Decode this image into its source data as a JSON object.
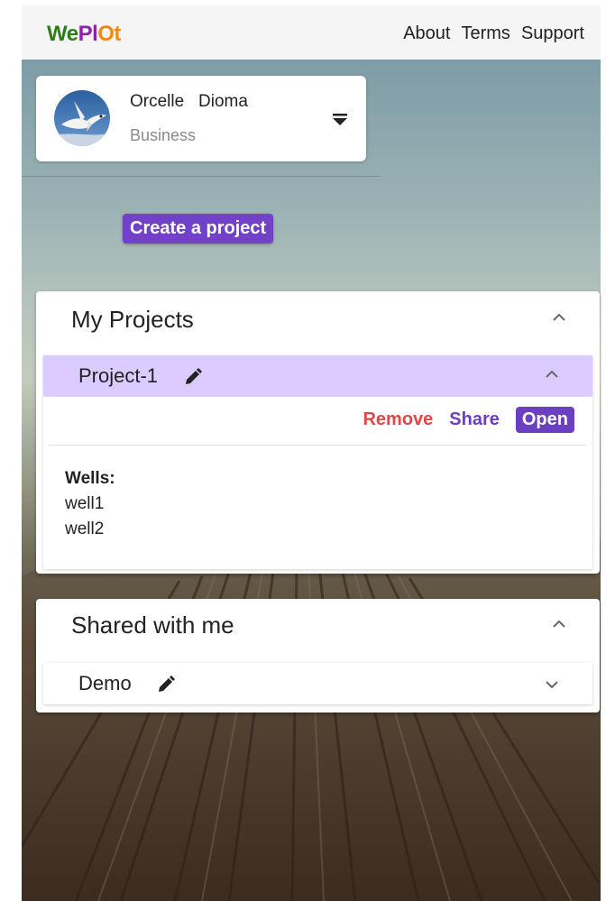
{
  "header": {
    "logo": [
      {
        "text": "We",
        "color": "#2e7d1a"
      },
      {
        "text": "Pl",
        "color": "#8e24aa"
      },
      {
        "text": "Ot",
        "color": "#ef8a10"
      }
    ],
    "nav": [
      "About",
      "Terms",
      "Support"
    ]
  },
  "user": {
    "name": "Orcelle   Dioma",
    "plan": "Business"
  },
  "create_button": "Create a project",
  "my_projects": {
    "title": "My Projects",
    "project": {
      "name": "Project-1",
      "actions": {
        "remove": "Remove",
        "share": "Share",
        "open": "Open"
      },
      "wells_label": "Wells:",
      "wells": [
        "well1",
        "well2"
      ],
      "highlight_color": "#dccbff"
    }
  },
  "shared": {
    "title": "Shared with me",
    "project": {
      "name": "Demo"
    }
  },
  "colors": {
    "accent": "#6a3fc0",
    "danger": "#e04848"
  }
}
